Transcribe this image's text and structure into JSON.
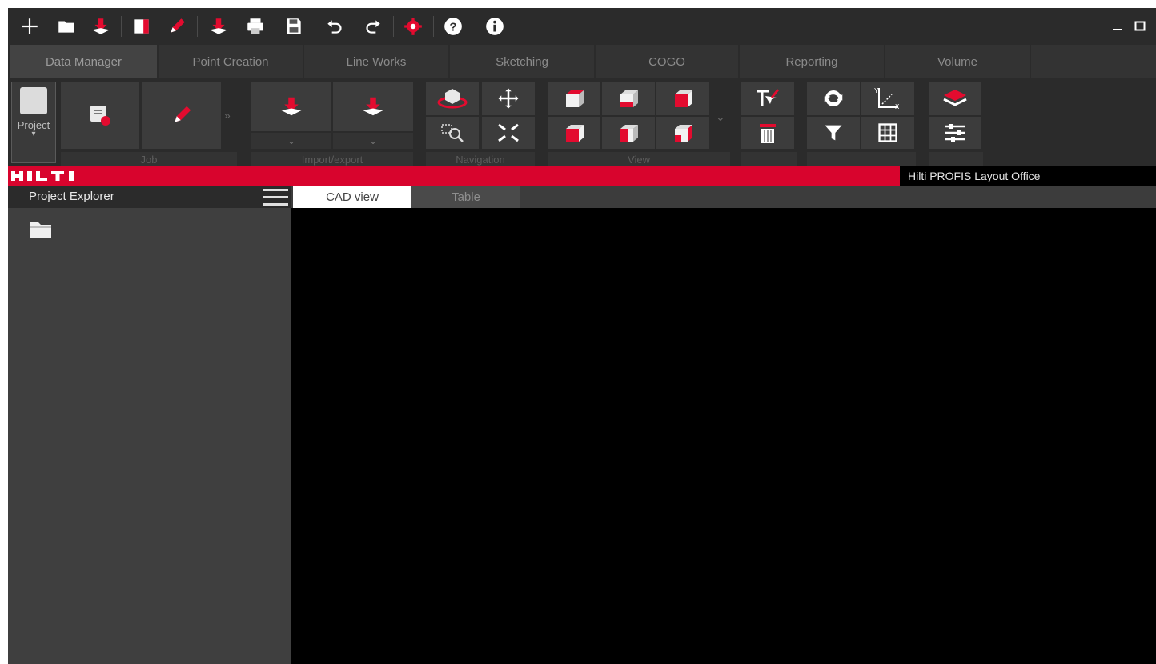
{
  "app": {
    "product_name": "Hilti PROFIS Layout Office",
    "brand_logo_text": "HILTI",
    "brand_color": "#d8042d"
  },
  "quick_access": [
    {
      "icon": "plus-icon"
    },
    {
      "icon": "folder-icon"
    },
    {
      "icon": "import-icon"
    },
    {
      "icon": "stop-icon"
    },
    {
      "icon": "pencil-icon"
    },
    {
      "icon": "import-icon"
    },
    {
      "icon": "print-icon"
    },
    {
      "icon": "save-icon"
    },
    {
      "icon": "undo-icon"
    },
    {
      "icon": "redo-icon"
    },
    {
      "icon": "gear-icon"
    },
    {
      "icon": "help-icon"
    },
    {
      "icon": "info-icon"
    }
  ],
  "window_controls": [
    {
      "icon": "minimize-icon"
    },
    {
      "icon": "maximize-icon"
    }
  ],
  "tabs": [
    {
      "label": "Data Manager",
      "active": true
    },
    {
      "label": "Point Creation"
    },
    {
      "label": "Line Works"
    },
    {
      "label": "Sketching"
    },
    {
      "label": "COGO"
    },
    {
      "label": "Reporting"
    },
    {
      "label": "Volume"
    }
  ],
  "ribbon": {
    "project_label": "Project",
    "groups": {
      "job": "Job",
      "import_export": "Import/export",
      "navigation": "Navigation",
      "view": "View"
    }
  },
  "explorer": {
    "title": "Project Explorer"
  },
  "view_tabs": [
    {
      "label": "CAD view",
      "active": true
    },
    {
      "label": "Table"
    }
  ]
}
